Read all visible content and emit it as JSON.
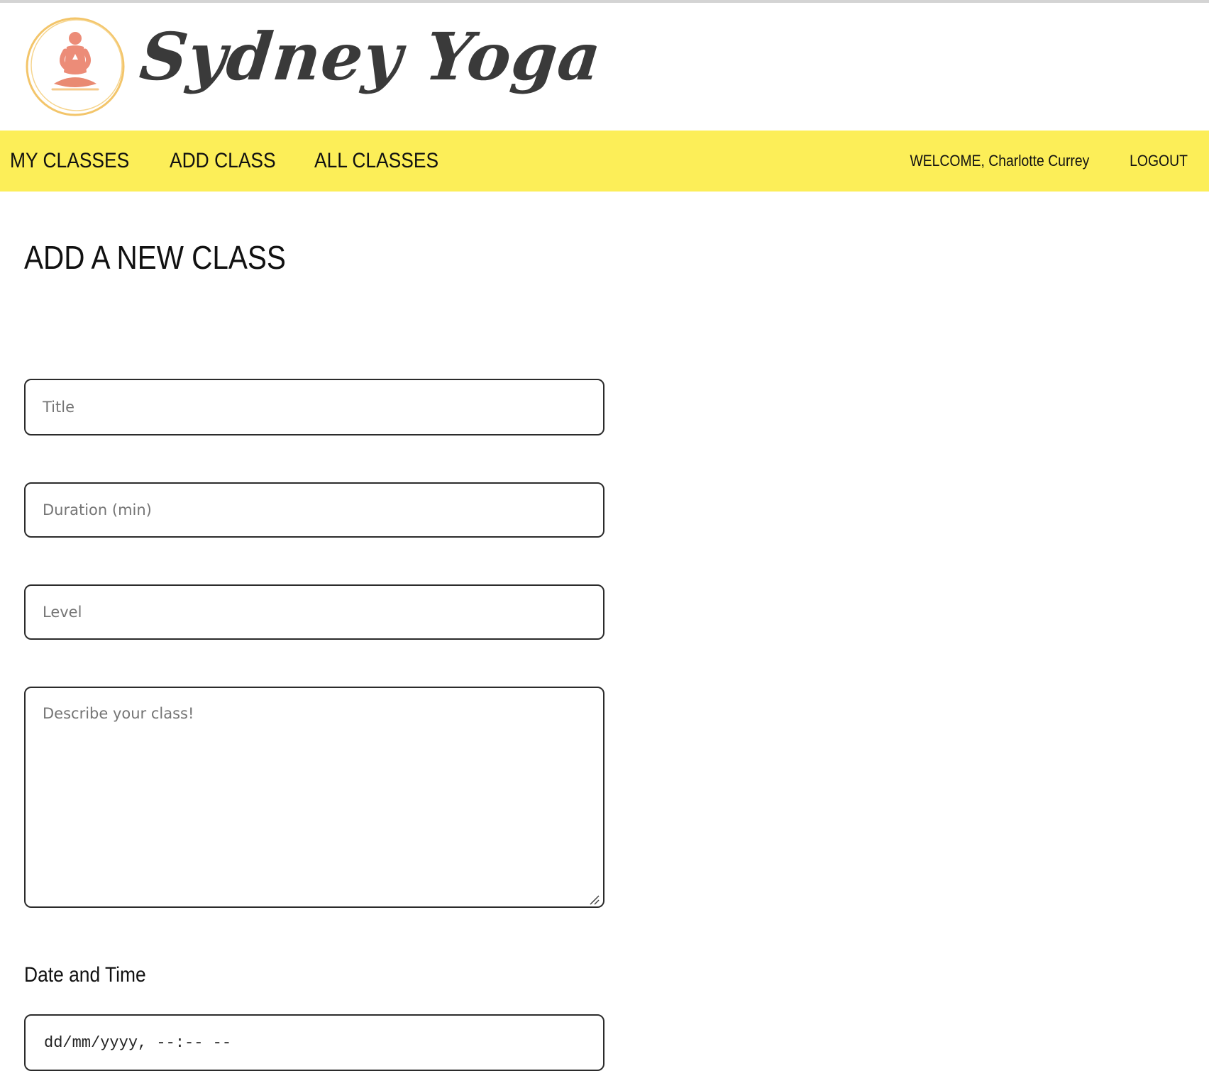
{
  "header": {
    "brand": "Sydney Yoga",
    "logo_icon": "meditating-figure-icon"
  },
  "nav": {
    "links": [
      "MY CLASSES",
      "ADD CLASS",
      "ALL CLASSES"
    ],
    "welcome": "WELCOME, Charlotte Currey",
    "logout": "LOGOUT"
  },
  "main": {
    "title": "ADD A NEW CLASS",
    "form": {
      "title_placeholder": "Title",
      "duration_placeholder": "Duration (min)",
      "level_placeholder": "Level",
      "description_placeholder": "Describe your class!",
      "datetime_label": "Date and Time",
      "datetime_placeholder": "dd/mm/yyyy, --:-- --"
    }
  },
  "colors": {
    "navbar": "#fcee58",
    "text": "#111111",
    "border": "#2b2b2b",
    "logo_ring": "#f3c56a",
    "logo_figure": "#ec8c78"
  }
}
